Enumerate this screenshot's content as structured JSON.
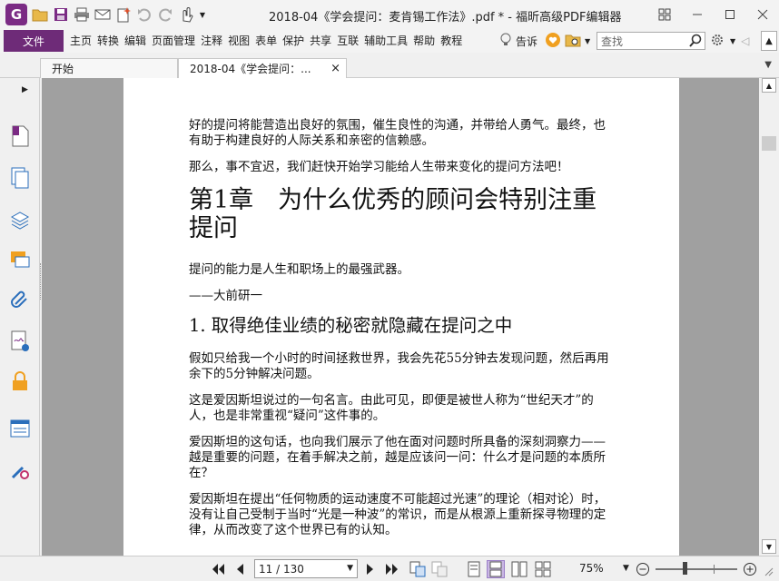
{
  "titlebar": {
    "logo_letter": "G",
    "title": "2018-04《学会提问：麦肯锡工作法》.pdf * - 福昕高级PDF编辑器"
  },
  "menubar": {
    "file_label": "文件",
    "items": [
      "主页",
      "转换",
      "编辑",
      "页面管理",
      "注释",
      "视图",
      "表单",
      "保护",
      "共享",
      "互联",
      "辅助工具",
      "帮助",
      "教程"
    ],
    "tell_label": "告诉",
    "search_placeholder": "查找"
  },
  "tabs": [
    {
      "label": "开始"
    },
    {
      "label": "2018-04《学会提问：...",
      "close": "×"
    }
  ],
  "document": {
    "paragraphs_top": [
      "好的提问将能营造出良好的氛围，催生良性的沟通，并带给人勇气。最终，也有助于构建良好的人际关系和亲密的信赖感。",
      "那么，事不宜迟，我们赶快开始学习能给人生带来变化的提问方法吧！"
    ],
    "chapter_title": "第1章　为什么优秀的顾问会特别注重提问",
    "quote": "提问的能力是人生和职场上的最强武器。",
    "quote_author": "——大前研一",
    "section_title": "1. 取得绝佳业绩的秘密就隐藏在提问之中",
    "paragraphs_bottom": [
      "假如只给我一个小时的时间拯救世界，我会先花55分钟去发现问题，然后再用余下的5分钟解决问题。",
      "这是爱因斯坦说过的一句名言。由此可见，即便是被世人称为“世纪天才”的人，也是非常重视“疑问”这件事的。",
      "爱因斯坦的这句话，也向我们展示了他在面对问题时所具备的深刻洞察力——越是重要的问题，在着手解决之前，越是应该问一问：什么才是问题的本质所在？",
      "爱因斯坦在提出“任何物质的运动速度不可能超过光速”的理论（相对论）时，没有让自己受制于当时“光是一种波”的常识，而是从根源上重新探寻物理的定律，从而改变了这个世界已有的认知。"
    ]
  },
  "statusbar": {
    "page_indicator": "11 / 130",
    "zoom": "75%"
  },
  "colors": {
    "brand": "#6e2b78",
    "doc_background": "#a0a0a0"
  }
}
